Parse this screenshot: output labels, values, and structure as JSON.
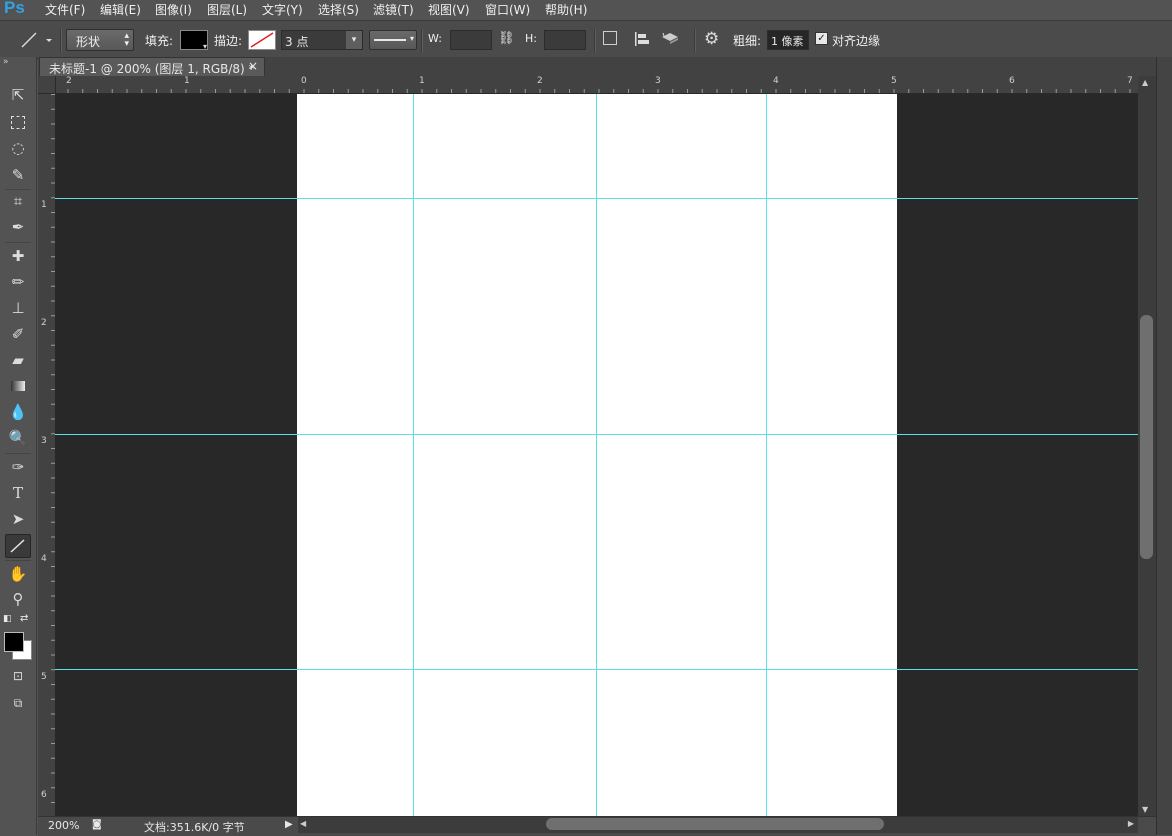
{
  "app": {
    "logo": "Ps"
  },
  "menu": [
    "文件(F)",
    "编辑(E)",
    "图像(I)",
    "图层(L)",
    "文字(Y)",
    "选择(S)",
    "滤镜(T)",
    "视图(V)",
    "窗口(W)",
    "帮助(H)"
  ],
  "options": {
    "tool_icon": "line-tool-icon",
    "mode": "形状",
    "fill_label": "填充:",
    "stroke_label": "描边:",
    "stroke_size": "3 点",
    "w_label": "W:",
    "h_label": "H:",
    "weight_label": "粗细:",
    "weight_value": "1 像素",
    "align_edges_label": "对齐边缘",
    "align_edges_checked": true
  },
  "document": {
    "tab_title": "未标题-1 @ 200% (图层 1, RGB/8) *",
    "close": "×"
  },
  "rulers": {
    "top_labels": [
      "2",
      "1",
      "0",
      "1",
      "2",
      "3",
      "4",
      "5",
      "6",
      "7"
    ],
    "left_labels": [
      "1",
      "2",
      "3",
      "4",
      "5",
      "6"
    ]
  },
  "status": {
    "zoom": "200%",
    "doc_info": "文档:351.6K/0 字节"
  },
  "colors": {
    "guide": "#5fe0e6",
    "pasteboard": "#282828",
    "artboard": "#ffffff",
    "logo": "#2fa3e6"
  },
  "tools": [
    "move-tool-icon",
    "marquee-tool-icon",
    "lasso-tool-icon",
    "quick-select-tool-icon",
    "crop-tool-icon",
    "eyedropper-tool-icon",
    "healing-brush-tool-icon",
    "brush-tool-icon",
    "clone-stamp-tool-icon",
    "history-brush-tool-icon",
    "eraser-tool-icon",
    "gradient-tool-icon",
    "blur-tool-icon",
    "dodge-tool-icon",
    "pen-tool-icon",
    "type-tool-icon",
    "path-select-tool-icon",
    "line-tool-icon",
    "hand-tool-icon",
    "zoom-tool-icon"
  ],
  "tool_glyphs": {
    "type": "T"
  }
}
